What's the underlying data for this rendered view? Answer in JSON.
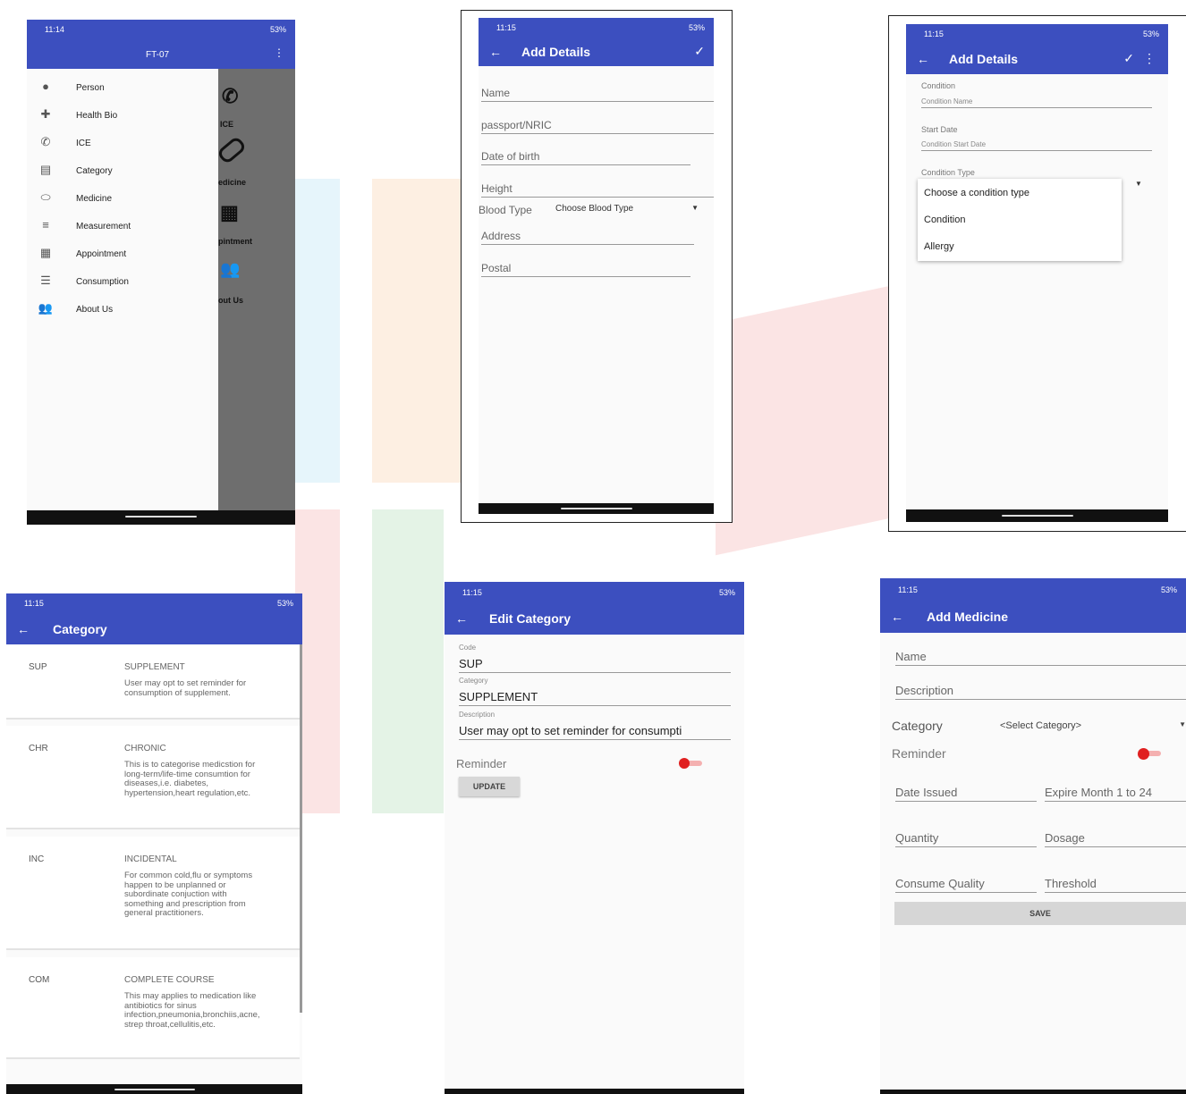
{
  "status": {
    "time_a": "11:14",
    "time_b": "11:15",
    "battery": "53%"
  },
  "drawer": {
    "header_title": "FT-07",
    "items": [
      {
        "label": "Person",
        "icon": "person-icon"
      },
      {
        "label": "Health Bio",
        "icon": "medkit-icon"
      },
      {
        "label": "ICE",
        "icon": "phone-icon"
      },
      {
        "label": "Category",
        "icon": "storage-icon"
      },
      {
        "label": "Medicine",
        "icon": "pill-icon"
      },
      {
        "label": "Measurement",
        "icon": "lines-icon"
      },
      {
        "label": "Appointment",
        "icon": "calendar-icon"
      },
      {
        "label": "Consumption",
        "icon": "list-icon"
      },
      {
        "label": "About Us",
        "icon": "people-icon"
      }
    ],
    "behind_labels": [
      "ICE",
      "edicine",
      "pintment",
      "out Us"
    ]
  },
  "add_details_person": {
    "title": "Add Details",
    "fields": [
      "Name",
      "passport/NRIC",
      "Date of birth",
      "Height"
    ],
    "blood_type_label": "Blood Type",
    "blood_type_value": "Choose Blood Type",
    "address": "Address",
    "postal": "Postal"
  },
  "add_details_condition": {
    "title": "Add Details",
    "condition_label": "Condition",
    "condition_hint": "Condition Name",
    "start_label": "Start Date",
    "start_hint": "Condition Start Date",
    "type_label": "Condition Type",
    "options": [
      "Choose a condition type",
      "Condition",
      "Allergy"
    ]
  },
  "category_list": {
    "title": "Category",
    "rows": [
      {
        "code": "SUP",
        "name": "SUPPLEMENT",
        "desc": "User may opt to set reminder for consumption of supplement."
      },
      {
        "code": "CHR",
        "name": "CHRONIC",
        "desc": "This is to categorise medicstion for long-term/life-time consumtion for diseases,i.e. diabetes, hypertension,heart regulation,etc."
      },
      {
        "code": "INC",
        "name": "INCIDENTAL",
        "desc": "For common cold,flu or symptoms happen to be unplanned or subordinate conjuction with something and prescription from general practitioners."
      },
      {
        "code": "COM",
        "name": "COMPLETE COURSE",
        "desc": "This may applies to medication like antibiotics for sinus infection,pneumonia,bronchiis,acne,strep throat,cellulitis,etc."
      }
    ]
  },
  "edit_category": {
    "title": "Edit Category",
    "code_label": "Code",
    "code_value": "SUP",
    "cat_label": "Category",
    "cat_value": "SUPPLEMENT",
    "desc_label": "Description",
    "desc_value": "User may opt to set reminder for consumpti",
    "reminder": "Reminder",
    "update": "UPDATE"
  },
  "add_medicine": {
    "title": "Add Medicine",
    "name": "Name",
    "description": "Description",
    "category_label": "Category",
    "category_value": "<Select Category>",
    "reminder": "Reminder",
    "date_issued": "Date Issued",
    "expire": "Expire Month 1 to 24",
    "quantity": "Quantity",
    "dosage": "Dosage",
    "consume": "Consume Quality",
    "threshold": "Threshold",
    "save": "SAVE"
  },
  "colors": {
    "primary": "#3c4fbf",
    "toggle": "#e02020"
  }
}
